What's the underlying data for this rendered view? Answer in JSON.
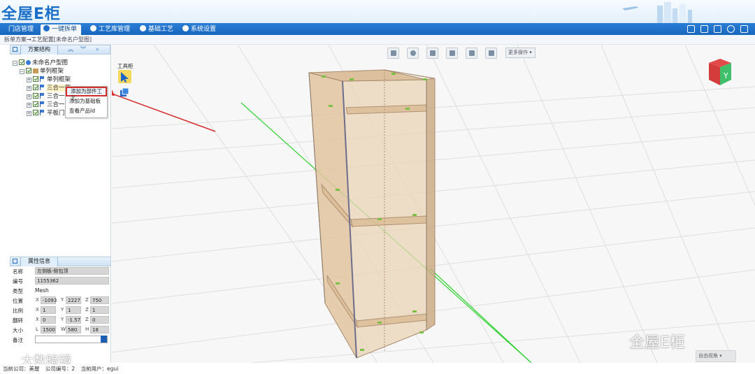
{
  "app": {
    "logo": "全屋E柜"
  },
  "nav": {
    "tabs": [
      {
        "label": "门店管理"
      },
      {
        "label": "一键拆单"
      },
      {
        "label": "工艺库管理"
      },
      {
        "label": "基础工艺"
      },
      {
        "label": "系统设置"
      }
    ],
    "right_icons": [
      "screen-icon",
      "save-icon",
      "user-icon",
      "gear-icon",
      "exit-icon"
    ]
  },
  "breadcrumb": "拆单方案→工艺配置[未命名户型图]",
  "left_panel": {
    "scheme_title": "方案结构",
    "tree": [
      {
        "label": "未命名户型图"
      },
      {
        "label": "单列框架"
      },
      {
        "label": "单列框架"
      },
      {
        "label": "三合一侧"
      },
      {
        "label": "三合一层"
      },
      {
        "label": "三合一层"
      },
      {
        "label": "平板门-"
      }
    ],
    "context_menu": [
      {
        "label": "添加为部件工艺"
      },
      {
        "label": "添加为基础板"
      },
      {
        "label": "查看产品Id"
      }
    ],
    "props_title": "属性信息",
    "props": {
      "name_label": "名称",
      "name_value": "左侧板-侧包顶",
      "code_label": "编号",
      "code_value": "1155362",
      "type_label": "类型",
      "type_value": "Mesh",
      "pos_label": "位置",
      "pos_x": "-1093",
      "pos_y": "2227",
      "pos_z": "750",
      "scale_label": "比例",
      "scale_x": "1",
      "scale_y": "1",
      "scale_z": "1",
      "rot_label": "翻转",
      "rot_x": "0",
      "rot_y": "-1.57",
      "rot_z": "0",
      "size_label": "大小",
      "size_l": "1500",
      "size_w": "580",
      "size_h": "18",
      "remark_label": "备注",
      "ax_x": "X",
      "ax_y": "Y",
      "ax_z": "Z",
      "ax_l": "L",
      "ax_w": "W",
      "ax_h": "H"
    }
  },
  "scene": {
    "toolbar_more": "更多操作",
    "toolcab_label": "工具柜",
    "view_cube_label": "Y",
    "view_select": "自由视角",
    "watermark": "全屋E柜",
    "watermark2": "大数暗镜"
  },
  "status": {
    "company": "当前公司：美屋",
    "code": "公司编号：2",
    "user": "当前用户：egui"
  },
  "colors": {
    "nav_blue": "#1f6fc9",
    "cabinet": "#e2c4a0",
    "grid_green": "#2fd12f",
    "highlight_red": "#d52c2c"
  }
}
